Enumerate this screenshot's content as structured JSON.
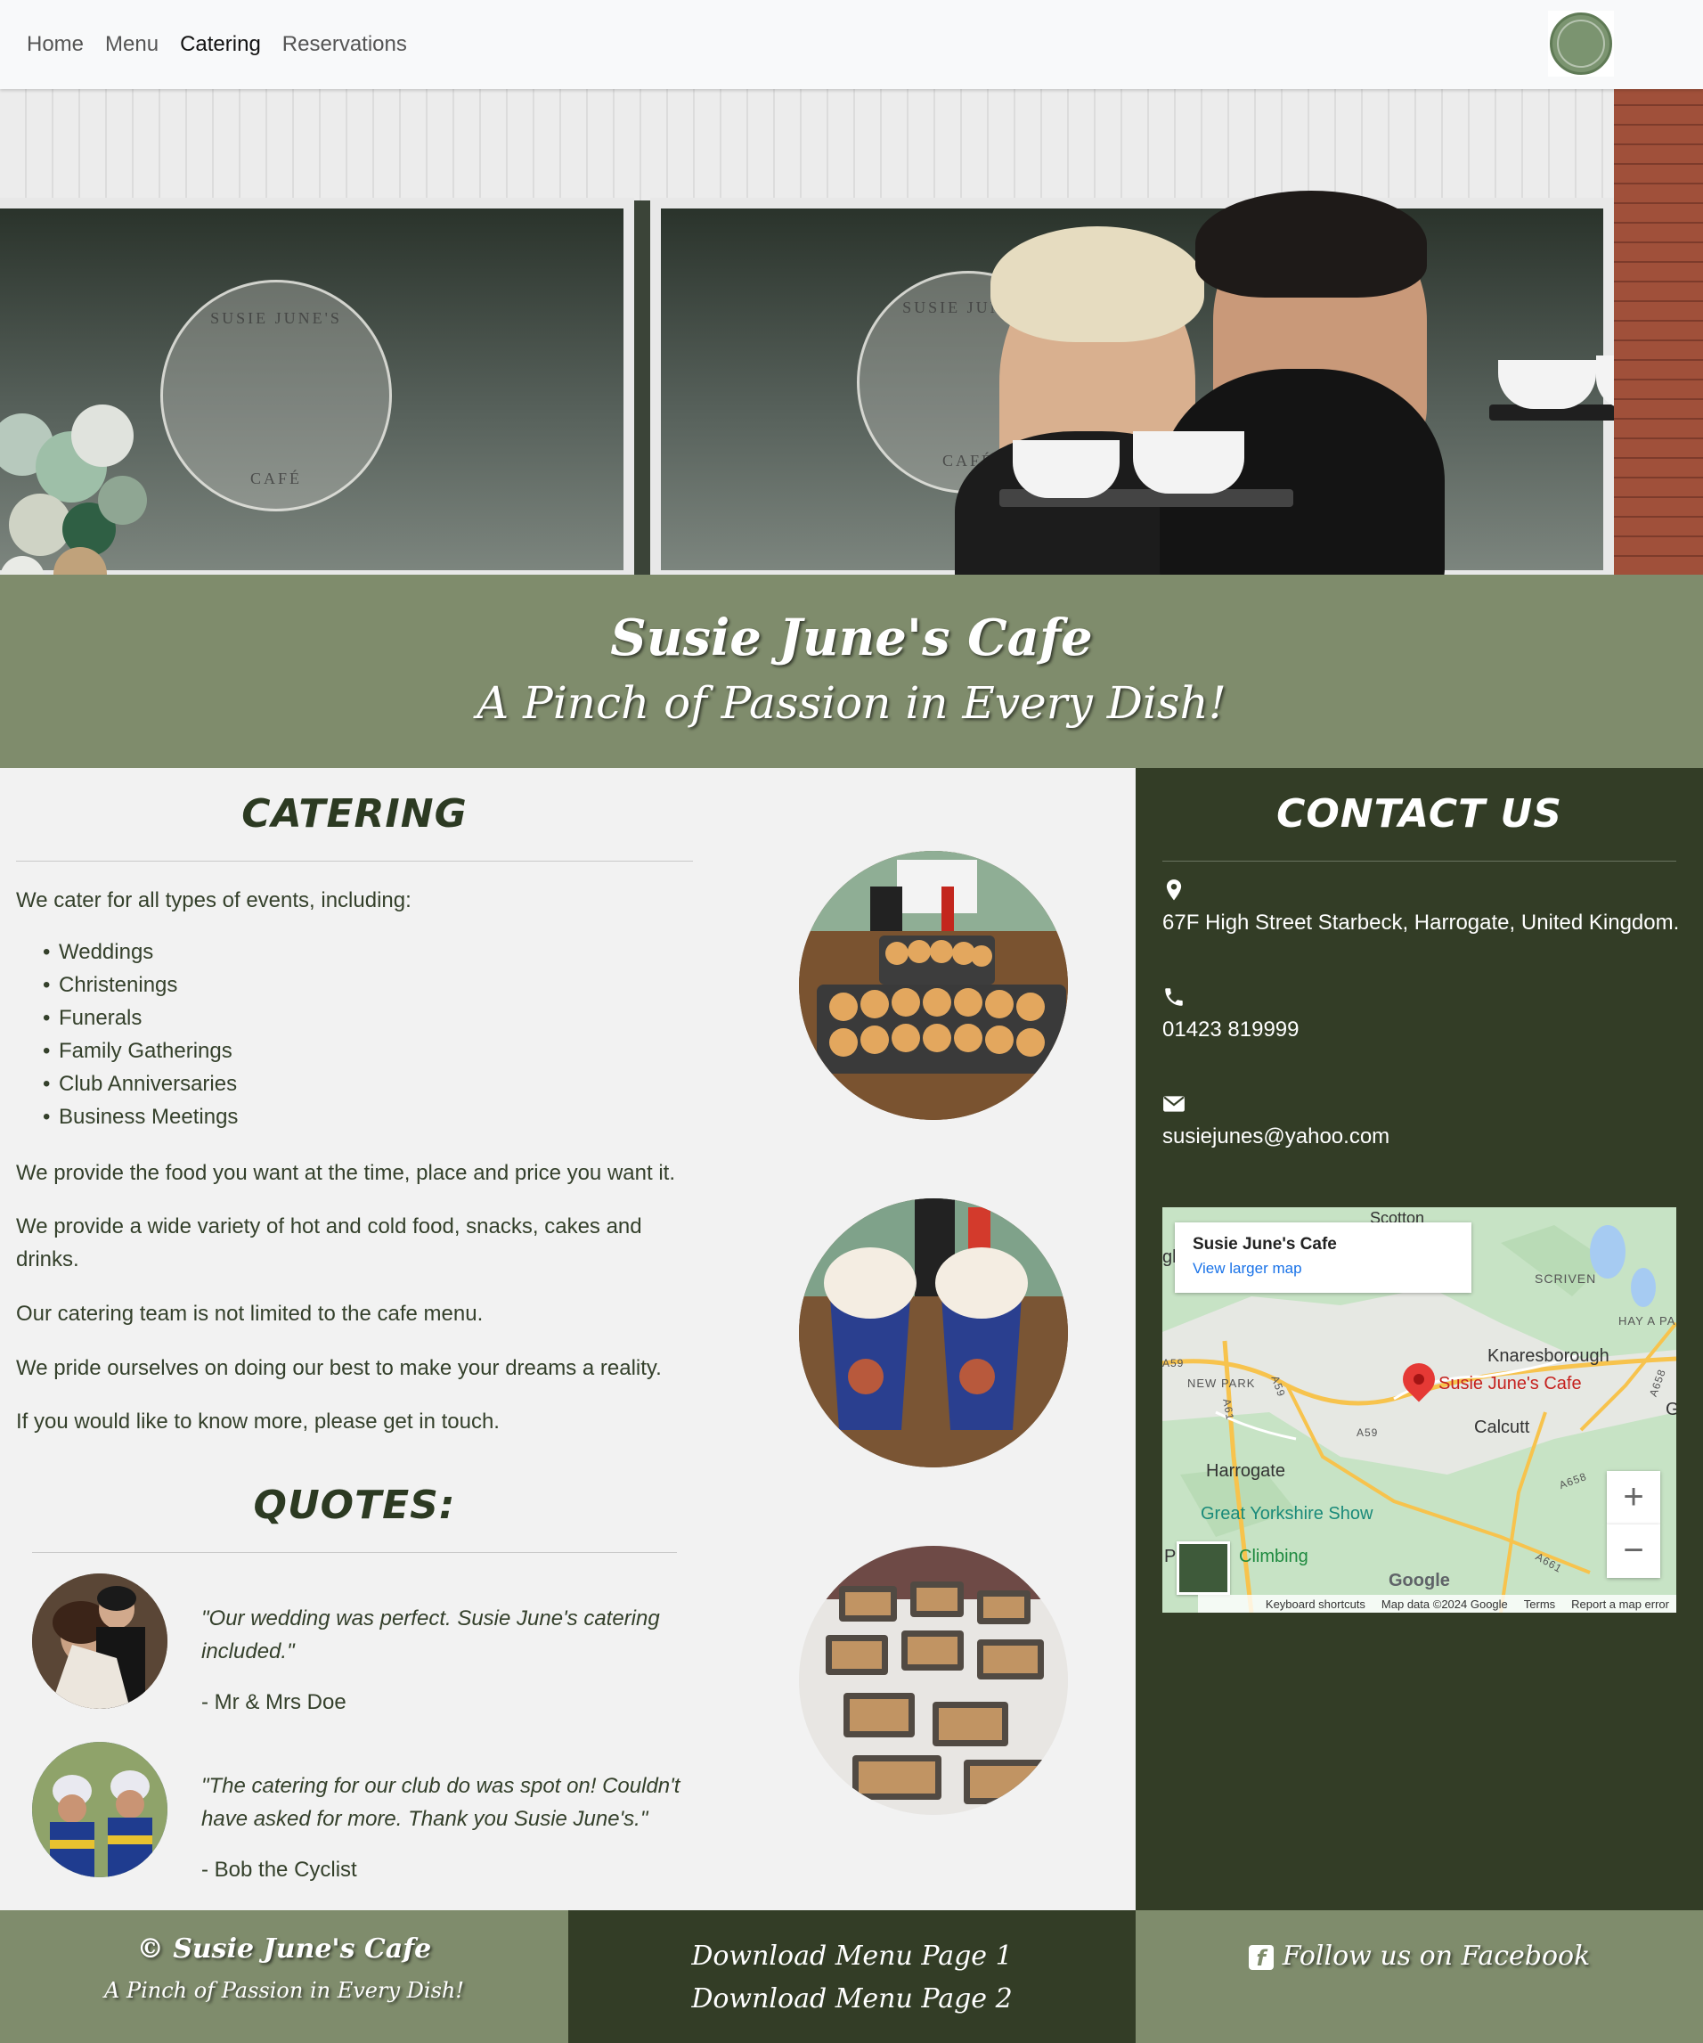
{
  "nav": {
    "links": [
      "Home",
      "Menu",
      "Catering",
      "Reservations"
    ],
    "active": "Catering",
    "logo_icon": "cafe-logo-icon"
  },
  "banner": {
    "title": "Susie June's Cafe",
    "subtitle": "A Pinch of Passion in Every Dish!"
  },
  "catering": {
    "heading": "CATERING",
    "intro": "We cater for all types of events, including:",
    "events": [
      "Weddings",
      "Christenings",
      "Funerals",
      "Family Gatherings",
      "Club Anniversaries",
      "Business Meetings"
    ],
    "paragraphs": [
      "We provide the food you want at the time, place and price you want it.",
      "We provide a wide variety of hot and cold food, snacks, cakes and drinks.",
      "Our catering team is not limited to the cafe menu.",
      "We pride ourselves on doing our best to make your dreams a reality.",
      "If you would like to know more, please get in touch."
    ]
  },
  "quotes": {
    "heading": "QUOTES:",
    "items": [
      {
        "text": "\"Our wedding was perfect. Susie June's catering included.\"",
        "author": "- Mr & Mrs Doe"
      },
      {
        "text": "\"The catering for our club do was spot on! Couldn't have asked for more. Thank you Susie June's.\"",
        "author": "- Bob the Cyclist"
      }
    ]
  },
  "contact": {
    "heading": "CONTACT US",
    "address": "67F High Street Starbeck, Harrogate, United Kingdom.",
    "phone": "01423 819999",
    "email": "susiejunes@yahoo.com",
    "icons": [
      "map-marker-icon",
      "phone-icon",
      "envelope-icon"
    ]
  },
  "map": {
    "place_name": "Susie June's Cafe",
    "view_larger": "View larger map",
    "labels": {
      "scotton": "Scotton",
      "scriven": "SCRIVEN",
      "hay_a_park": "HAY A PA",
      "knaresborough": "Knaresborough",
      "pin_label": "Susie June's Cafe",
      "calcutt": "Calcutt",
      "new_park": "NEW PARK",
      "harrogate": "Harrogate",
      "great_yorkshire_show": "Great Yorkshire Show",
      "climbing": "Climbing",
      "a59_left": "A59",
      "a59_mid": "A59",
      "a59_vert": "A59",
      "a61": "A61",
      "a658_right": "A658",
      "a658_bottom": "A658",
      "a661": "A661",
      "edge_gl": "gl",
      "edge_g": "G",
      "edge_p": "P"
    },
    "google": "Google",
    "footer": [
      "Keyboard shortcuts",
      "Map data ©2024 Google",
      "Terms",
      "Report a map error"
    ],
    "zoom_in": "+",
    "zoom_out": "−"
  },
  "footer": {
    "copyright_title": "© Susie June's Cafe",
    "copyright_sub": "A Pinch of Passion in Every Dish!",
    "download1": "Download Menu Page 1",
    "download2": "Download Menu Page 2",
    "facebook": "Follow us on Facebook"
  },
  "colors": {
    "olive": "#7f8c6c",
    "dark_green": "#333d26",
    "light_bg": "#f2f2f2"
  }
}
